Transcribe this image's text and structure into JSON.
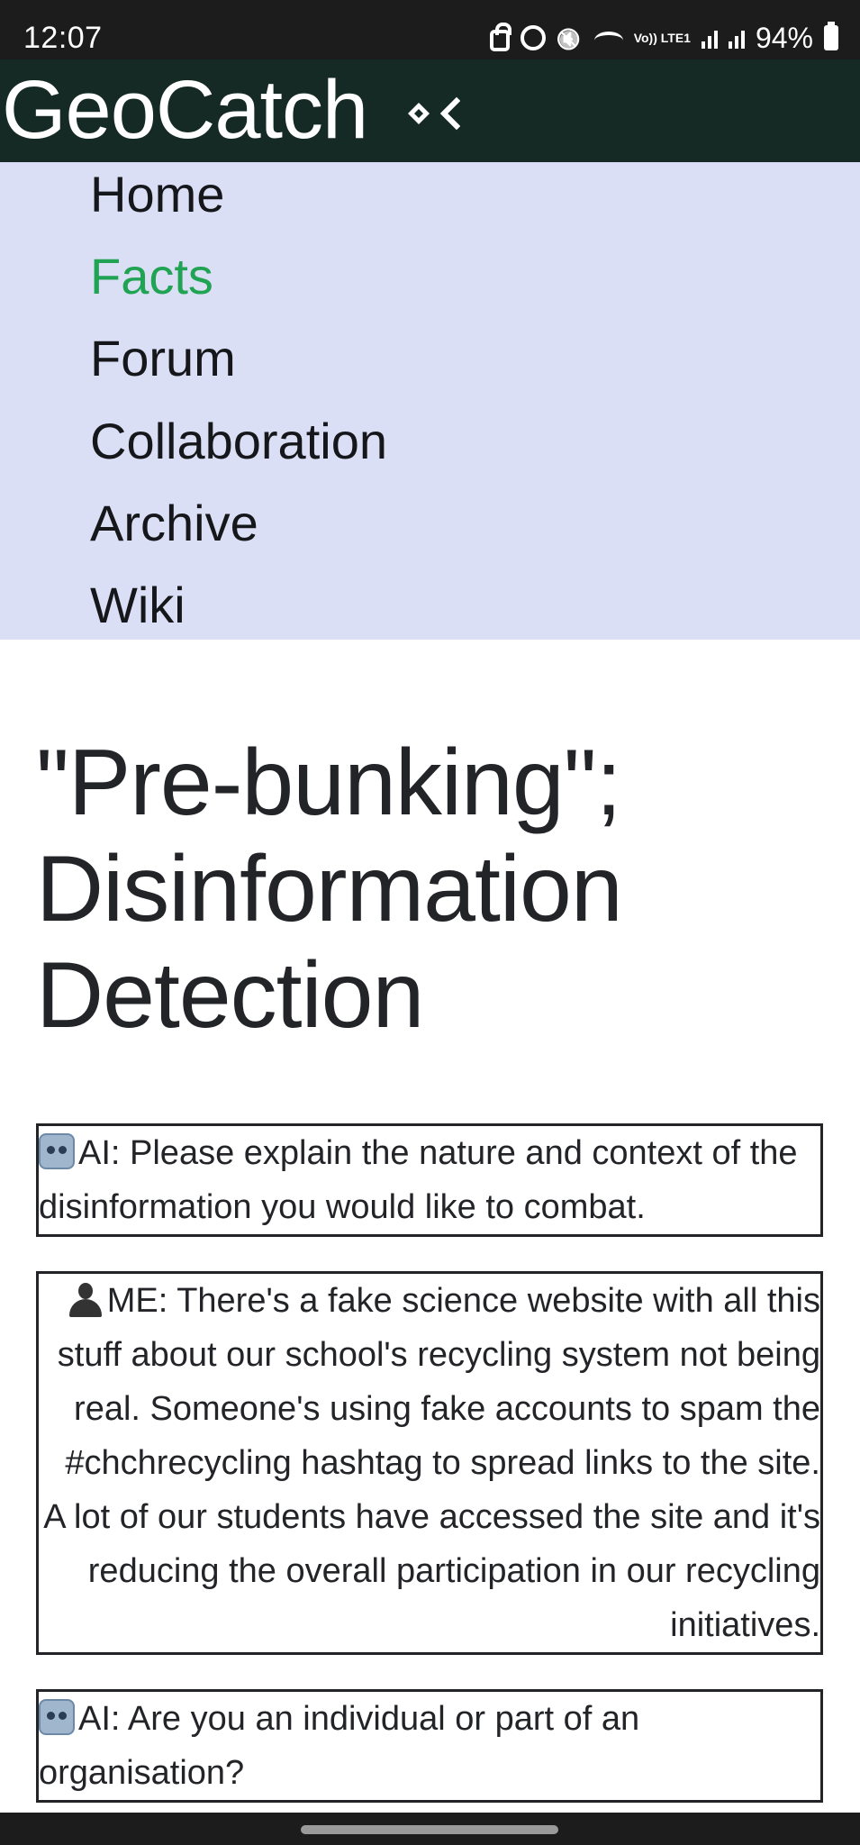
{
  "status_bar": {
    "time": "12:07",
    "network_label": "Vo)) LTE1",
    "battery": "94%"
  },
  "header": {
    "site_title": "GeoCatch",
    "logo_icon": "chevron-diamond-icon",
    "colors": {
      "background": "#152a25",
      "text": "#ffffff"
    }
  },
  "nav": {
    "background": "#dbdff6",
    "active_color": "#20a353",
    "items": [
      {
        "label": "Home"
      },
      {
        "label": "Facts",
        "active": true
      },
      {
        "label": "Forum"
      },
      {
        "label": "Collaboration"
      },
      {
        "label": "Archive"
      },
      {
        "label": "Wiki"
      }
    ]
  },
  "main": {
    "title": "\"Pre-bunking\"; Disinformation Detection",
    "messages": [
      {
        "speaker": "AI",
        "icon": "robot-icon",
        "text": "AI: Please explain the nature and context of the disinformation you would like to combat."
      },
      {
        "speaker": "ME",
        "icon": "person-icon",
        "text": "ME: There's a fake science website with all this stuff about our school's recycling system not being real. Someone's using fake accounts to spam the #chchrecycling hashtag to spread links to the site. A lot of our students have accessed the site and it's reducing the overall participation in our recycling initiatives."
      },
      {
        "speaker": "AI",
        "icon": "robot-icon",
        "text": "AI: Are you an individual or part of an organisation?"
      }
    ]
  }
}
